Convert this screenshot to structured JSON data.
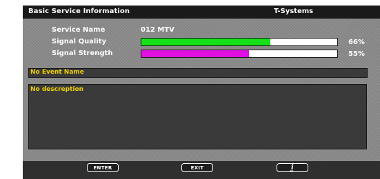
{
  "header": {
    "title": "Basic Service Information",
    "provider": "T-Systems"
  },
  "service": {
    "name_label": "Service Name",
    "name_value": "012  MTV"
  },
  "signal_quality": {
    "label": "Signal Quality",
    "percent_text": "66%",
    "value": 0.66,
    "color": "#16e016"
  },
  "signal_strength": {
    "label": "Signal Strength",
    "percent_text": "55%",
    "value": 0.55,
    "color": "#e010e0"
  },
  "event": {
    "name": "No Event Name",
    "description": "No descreption"
  },
  "buttons": {
    "enter": "ENTER",
    "exit": "EXIT",
    "info_icon": "info-icon"
  },
  "colors": {
    "event_text": "#f0d000",
    "panel": "#898989"
  }
}
